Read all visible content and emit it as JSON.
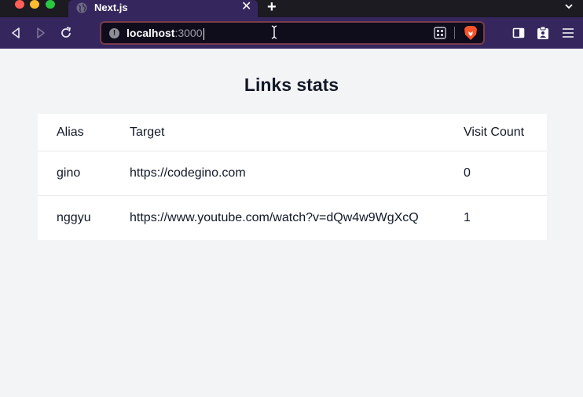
{
  "browser": {
    "tab": {
      "title": "Next.js",
      "close": "✕",
      "icon": "globe-icon"
    },
    "new_tab": "+",
    "url": {
      "host": "localhost",
      "port": ":3000"
    },
    "icons": [
      "back-icon",
      "forward-icon",
      "reload-icon",
      "info-icon",
      "qr-icon",
      "brave-lion-icon",
      "sidebar-icon",
      "wallet-icon",
      "menu-icon",
      "tab-list-icon"
    ]
  },
  "page": {
    "title": "Links stats",
    "table": {
      "headers": [
        "Alias",
        "Target",
        "Visit Count"
      ],
      "rows": [
        {
          "alias": "gino",
          "target": "https://codegino.com",
          "count": "0"
        },
        {
          "alias": "nggyu",
          "target": "https://www.youtube.com/watch?v=dQw4w9WgXcQ",
          "count": "1"
        }
      ]
    }
  },
  "colors": {
    "toolbar": "#35275e",
    "tabstrip": "#1c1b22",
    "page_bg": "#f3f4f6",
    "text": "#111827"
  }
}
